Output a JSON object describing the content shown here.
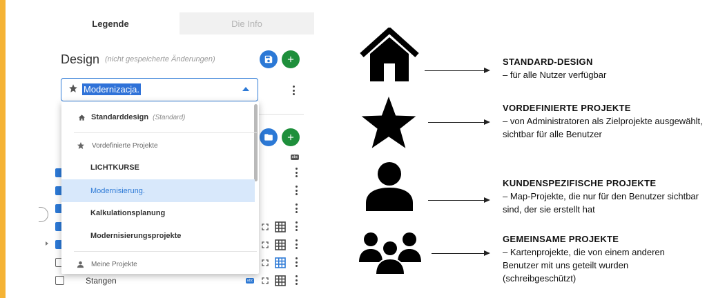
{
  "colors": {
    "accent_bar": "#f5b335",
    "blue": "#2c79d6",
    "green": "#1e8f3b",
    "selected_row": "#d8e8fb"
  },
  "tabs": [
    {
      "label": "Legende",
      "active": true
    },
    {
      "label": "Die Info",
      "active": false
    }
  ],
  "design": {
    "title": "Design",
    "subtitle": "(nicht gespeicherte Änderungen)",
    "save_icon": "save-icon",
    "add_icon": "plus-icon"
  },
  "select": {
    "value": "Modernizacja.",
    "icon": "star-icon"
  },
  "dropdown": {
    "standard": {
      "label": "Standarddesign",
      "hint": "(Standard)",
      "icon": "home-icon"
    },
    "group_predefined": {
      "label": "Vordefinierte Projekte",
      "icon": "star-icon"
    },
    "items": [
      {
        "label": "LICHTKURSE",
        "selected": false
      },
      {
        "label": "Modernisierung.",
        "selected": true
      },
      {
        "label": "Kalkulationsplanung",
        "selected": false
      },
      {
        "label": "Modernisierungsprojekte",
        "selected": false
      }
    ],
    "group_mine": {
      "label": "Meine Projekte",
      "icon": "person-icon"
    }
  },
  "background_list": {
    "last_item_label": "Stangen",
    "badge_text": "abc"
  },
  "legend": [
    {
      "icon": "home-icon",
      "title": "STANDARD-DESIGN",
      "desc": "– für alle Nutzer verfügbar"
    },
    {
      "icon": "star-icon",
      "title": "VORDEFINIERTE PROJEKTE",
      "desc": "– von Administratoren als Zielprojekte ausgewählt, sichtbar für alle Benutzer"
    },
    {
      "icon": "person-icon",
      "title": "KUNDENSPEZIFISCHE PROJEKTE",
      "desc": "– Map-Projekte, die nur für den Benutzer sichtbar sind, der sie erstellt hat"
    },
    {
      "icon": "group-icon",
      "title": "GEMEINSAME PROJEKTE",
      "desc": "– Kartenprojekte, die von einem anderen Benutzer mit uns geteilt wurden (schreibgeschützt)"
    }
  ]
}
